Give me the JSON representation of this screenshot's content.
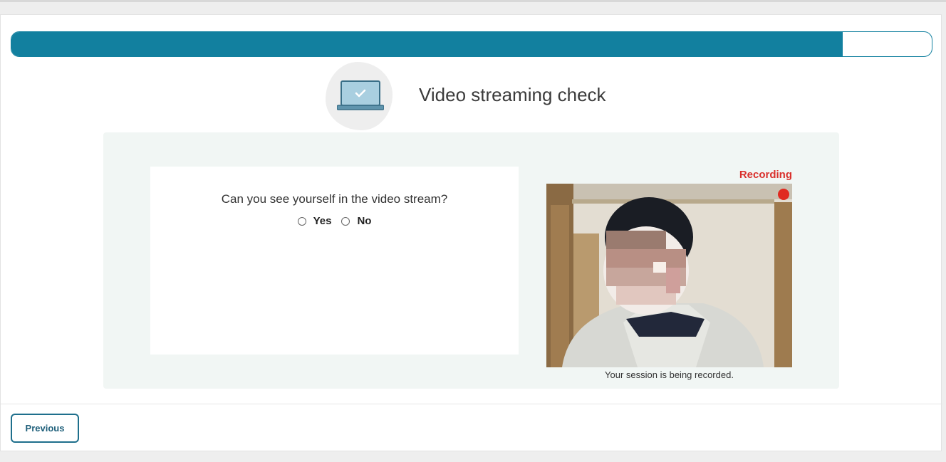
{
  "progress": {
    "fraction": 0.903
  },
  "header": {
    "title": "Video streaming check",
    "icon": "laptop-check-icon"
  },
  "question": {
    "text": "Can you see yourself in the video stream?",
    "options": [
      {
        "label": "Yes",
        "checked": false
      },
      {
        "label": "No",
        "checked": false
      }
    ]
  },
  "video": {
    "status_label": "Recording",
    "caption": "Your session is being recorded.",
    "status_color": "#e02a20"
  },
  "footer": {
    "previous_label": "Previous"
  },
  "colors": {
    "accent": "#12809f",
    "panel": "#f1f6f4"
  }
}
